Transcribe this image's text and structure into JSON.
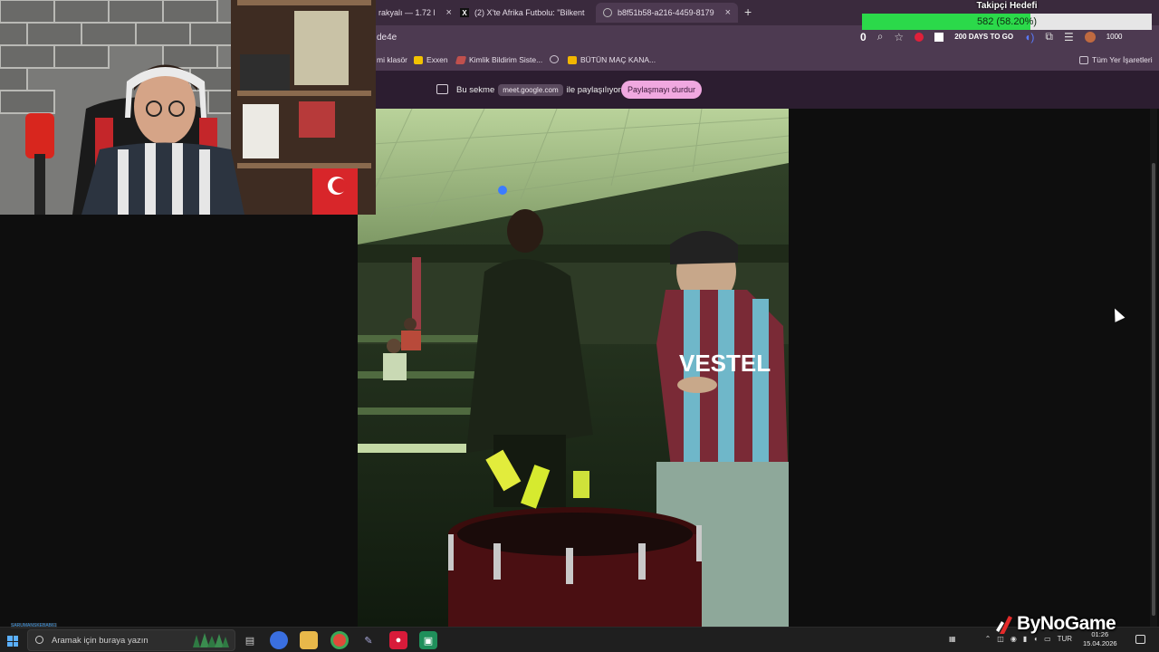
{
  "tabs": [
    {
      "label": "rakyalı — 1.72 l",
      "close": "×"
    },
    {
      "label": "(2) X'te Afrika Futbolu: \"Bilkent",
      "close": "×"
    },
    {
      "label": "b8f51b58-a216-4459-8179",
      "close": "×",
      "active": true
    }
  ],
  "new_tab": "+",
  "address": {
    "url_fragment": "de4e"
  },
  "toolbar": {
    "zero": "0",
    "days_label": "200 DAYS TO GO",
    "count": "1000"
  },
  "bookmarks": [
    {
      "label": "mi klasör",
      "icon_color": "#e8b84a"
    },
    {
      "label": "Exxen",
      "icon_color": "#f2c200"
    },
    {
      "label": "Kimlik Bildirim Siste...",
      "icon_color": "#c0504d"
    },
    {
      "label": "",
      "icon_color": "#888888"
    },
    {
      "label": "BÜTÜN MAÇ KANA...",
      "icon_color": "#f2b600"
    }
  ],
  "bookmarks_all": "Tüm Yer İşaretleri",
  "share": {
    "prefix": "Bu sekme",
    "host": "meet.google.com",
    "suffix": "ile paylaşılıyor",
    "stop_label": "Paylaşmayı durdur"
  },
  "goal": {
    "title": "Takipçi Hedefi",
    "progress_text": "582 (58.20%)",
    "current": 582,
    "fraction": 0.582
  },
  "video": {
    "jersey_text": "VESTEL"
  },
  "taskbar": {
    "search_placeholder": "Aramak için buraya yazın",
    "user_tag": "SARUMANSKEBAB61",
    "lang": "TUR",
    "time": "01:26",
    "date": "15.04.2026"
  },
  "watermark": "ByNoGame"
}
